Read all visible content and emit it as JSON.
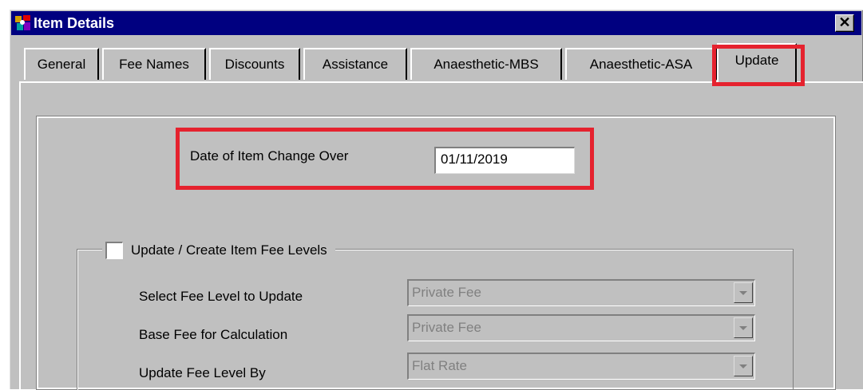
{
  "window": {
    "title": "Item Details",
    "close_glyph": "✕"
  },
  "tabs": [
    {
      "label": "General"
    },
    {
      "label": "Fee Names"
    },
    {
      "label": "Discounts"
    },
    {
      "label": "Assistance"
    },
    {
      "label": "Anaesthetic-MBS"
    },
    {
      "label": "Anaesthetic-ASA"
    },
    {
      "label": "Update",
      "active": true
    }
  ],
  "change_over": {
    "label": "Date of Item Change Over",
    "value": "01/11/2019"
  },
  "fee_levels": {
    "checkbox_label": "Update / Create Item Fee Levels",
    "checked": false,
    "rows": [
      {
        "label": "Select Fee Level to Update",
        "value": "Private Fee"
      },
      {
        "label": "Base Fee for Calculation",
        "value": "Private Fee"
      },
      {
        "label": "Update Fee Level By",
        "value": "Flat Rate"
      }
    ]
  },
  "colors": {
    "highlight": "#e5222e",
    "titlebar": "#000080",
    "face": "#c0c0c0"
  },
  "icons": {
    "app": "app-icon",
    "close": "close-icon",
    "dropdown": "chevron-down-icon"
  }
}
